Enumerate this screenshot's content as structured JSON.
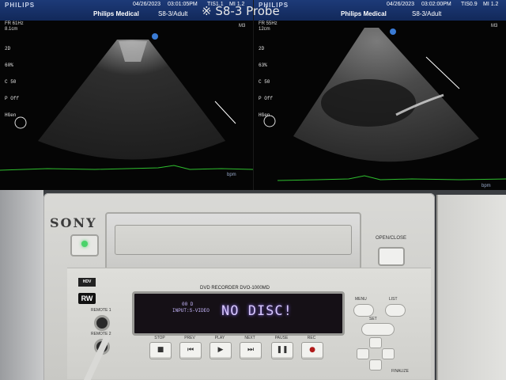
{
  "overlay_note": "※ S8-3 Probe",
  "ultrasound_left": {
    "brand": "PHILIPS",
    "date": "04/26/2023",
    "time": "03:01:05PM",
    "tis": "TIS1.1",
    "mi": "MI 1.2",
    "institution": "Philips Medical",
    "preset": "S8-3/Adult",
    "frame_rate": "FR 61Hz",
    "depth": "8.1cm",
    "params": [
      "2D",
      "60%",
      "C 50",
      "P Off",
      "HGen"
    ],
    "m_marker": "M3",
    "bpm": "bpm"
  },
  "ultrasound_right": {
    "brand": "PHILIPS",
    "date": "04/26/2023",
    "time": "03:02:00PM",
    "tis": "TIS0.9",
    "mi": "MI 1.2",
    "institution": "Philips Medical",
    "preset": "S8-3/Adult",
    "frame_rate": "FR 55Hz",
    "depth": "12cm",
    "params": [
      "2D",
      "63%",
      "C 50",
      "P Off",
      "HGen"
    ],
    "m_marker": "M3",
    "bpm": "bpm"
  },
  "recorder": {
    "brand": "SONY",
    "model": "DVD RECORDER DVO-1000MD",
    "open_close_label": "OPEN/CLOSE",
    "rw_logo": "RW",
    "hdv_logo": "HDV",
    "remote1_label": "REMOTE 1",
    "remote2_label": "REMOTE 2",
    "display": {
      "message": "NO DISC!",
      "counter": "00 D",
      "input": "INPUT:S-VIDEO"
    },
    "transport": [
      {
        "label": "STOP",
        "icon": "■"
      },
      {
        "label": "PREV",
        "icon": "⏮"
      },
      {
        "label": "PLAY",
        "icon": "▶"
      },
      {
        "label": "NEXT",
        "icon": "⏭"
      },
      {
        "label": "PAUSE",
        "icon": "❚❚"
      },
      {
        "label": "REC",
        "icon": "●"
      }
    ],
    "menu_label": "MENU",
    "list_label": "LIST",
    "set_label": "SET",
    "finalize_label": "FINALIZE"
  }
}
